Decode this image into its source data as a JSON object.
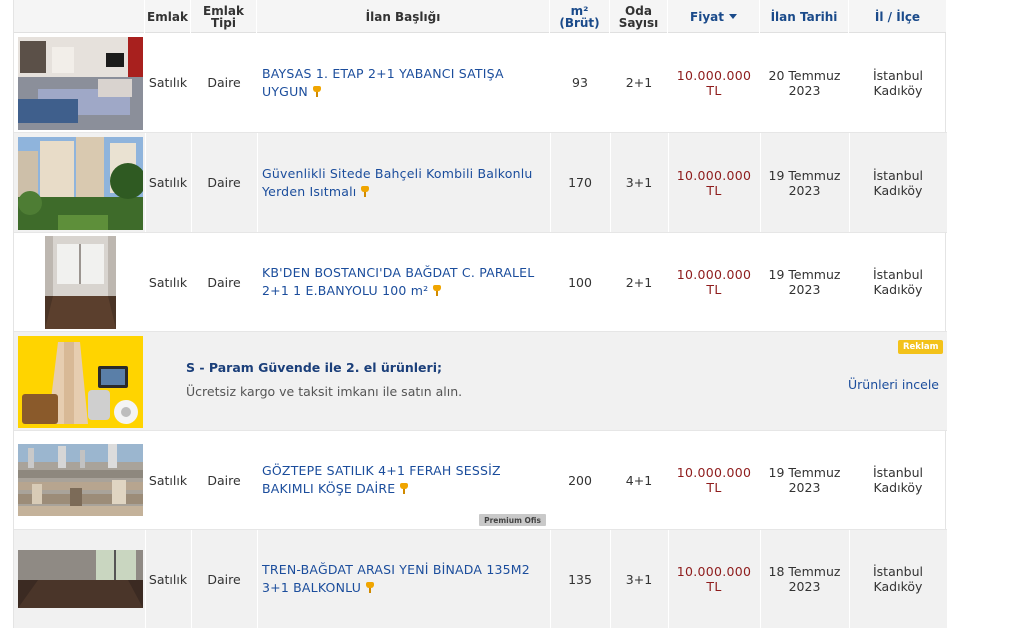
{
  "columns": {
    "emlak": "Emlak",
    "emlak_tipi": "Emlak Tipi",
    "ilan_basligi": "İlan Başlığı",
    "m2": "m² (Brüt)",
    "oda_sayisi": "Oda Sayısı",
    "fiyat": "Fiyat",
    "ilan_tarihi": "İlan Tarihi",
    "il_ilce": "İl / İlçe"
  },
  "listings": [
    {
      "image_icon": "living-room-photo",
      "emlak": "Satılık",
      "tip": "Daire",
      "title": "BAYSAS 1. ETAP 2+1 YABANCI SATIŞA UYGUN",
      "m2": "93",
      "oda": "2+1",
      "fiyat": "10.000.000 TL",
      "tarih_gun": "20 Temmuz",
      "tarih_yil": "2023",
      "il": "İstanbul",
      "ilce": "Kadıköy"
    },
    {
      "image_icon": "apartment-building-photo",
      "emlak": "Satılık",
      "tip": "Daire",
      "title": "Güvenlikli Sitede Bahçeli Kombili Balkonlu Yerden Isıtmalı",
      "m2": "170",
      "oda": "3+1",
      "fiyat": "10.000.000 TL",
      "tarih_gun": "19 Temmuz",
      "tarih_yil": "2023",
      "il": "İstanbul",
      "ilce": "Kadıköy"
    },
    {
      "image_icon": "empty-room-photo",
      "emlak": "Satılık",
      "tip": "Daire",
      "title": "KB'DEN BOSTANCI'DA BAĞDAT C. PARALEL 2+1 1 E.BANYOLU 100 m²",
      "m2": "100",
      "oda": "2+1",
      "fiyat": "10.000.000 TL",
      "tarih_gun": "19 Temmuz",
      "tarih_yil": "2023",
      "il": "İstanbul",
      "ilce": "Kadıköy"
    },
    {
      "image_icon": "city-aerial-photo",
      "emlak": "Satılık",
      "tip": "Daire",
      "title": "GÖZTEPE SATILIK 4+1 FERAH SESSİZ BAKIMLI KÖŞE DAİRE",
      "m2": "200",
      "oda": "4+1",
      "fiyat": "10.000.000 TL",
      "tarih_gun": "19 Temmuz",
      "tarih_yil": "2023",
      "il": "İstanbul",
      "ilce": "Kadıköy",
      "badge": "Premium Ofis"
    },
    {
      "image_icon": "empty-room-window-photo",
      "emlak": "Satılık",
      "tip": "Daire",
      "title": "TREN-BAĞDAT ARASI YENİ BİNADA 135M2 3+1 BALKONLU",
      "m2": "135",
      "oda": "3+1",
      "fiyat": "10.000.000 TL",
      "tarih_gun": "18 Temmuz",
      "tarih_yil": "2023",
      "il": "İstanbul",
      "ilce": "Kadıköy"
    }
  ],
  "ad": {
    "image_icon": "products-collage-photo",
    "title": "S - Param Güvende ile 2. el ürünleri;",
    "subtitle": "Ücretsiz kargo ve taksit imkanı ile satın alın.",
    "badge": "Reklam",
    "link": "Ürünleri incele"
  },
  "colors": {
    "link": "#1b4d9c",
    "price": "#8e1c1c",
    "header_bg": "#f5f5f5",
    "row_alt": "#f1f1f1",
    "ad_badge": "#f3c21a",
    "pin": "#f0a500"
  }
}
